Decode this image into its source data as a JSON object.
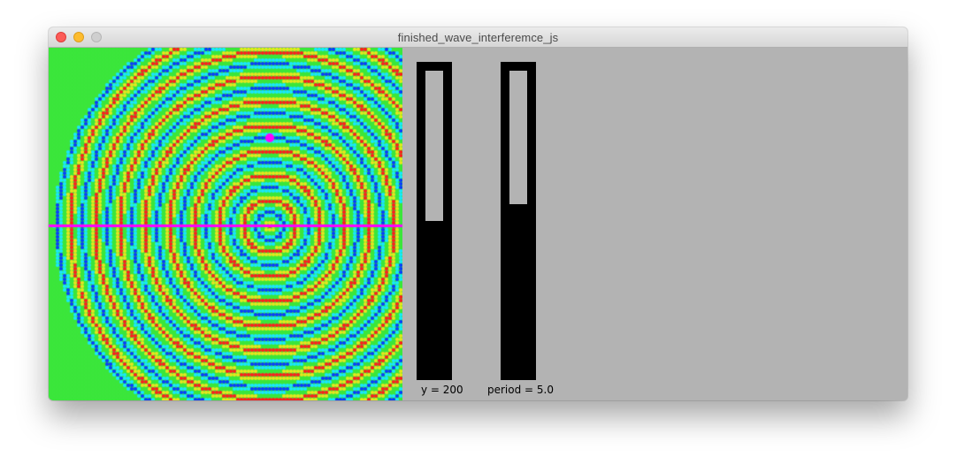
{
  "window": {
    "title": "finished_wave_interferemce_js"
  },
  "wave": {
    "source_row": 50,
    "source_col": 62,
    "grid_cells": 100,
    "line_row": 50,
    "colors": {
      "trough": "#0a3cff",
      "mid_low": "#18e6ff",
      "flat": "#3ce63c",
      "mid_high": "#e6e61e",
      "crest": "#ff1e1e",
      "source": "#ff00ff",
      "line": "#ff00ff"
    }
  },
  "sliders": [
    {
      "id": "y",
      "label": "y = 200",
      "value_fraction": 0.5
    },
    {
      "id": "period",
      "label": "period = 5.0",
      "value_fraction": 0.445
    }
  ]
}
